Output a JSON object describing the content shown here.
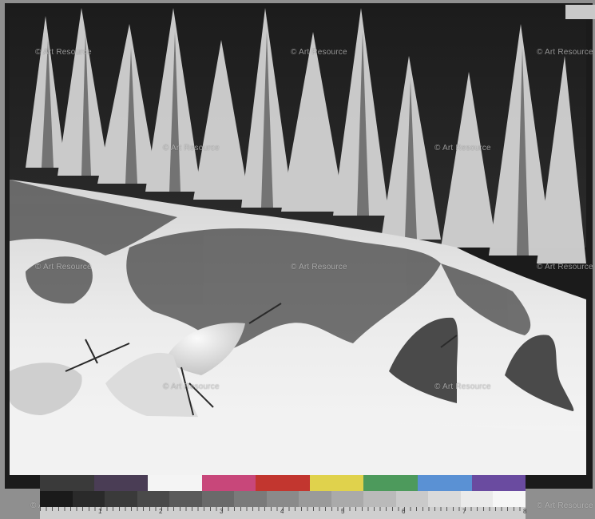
{
  "watermark_text": "© Art Resource",
  "colors": {
    "mount": "#1b1b1b",
    "snow_light": "#f0f0f0",
    "snow_mid": "#cdcdcd",
    "shadow": "#3a3a3a",
    "trees_dark": "#2a2a2a",
    "trees_snow": "#e4e4e4"
  },
  "color_swatches": [
    "#3a3a3a",
    "#4a3d55",
    "#f4f4f4",
    "#c8477a",
    "#c2362f",
    "#e0d24c",
    "#4d9a5c",
    "#5a91d4",
    "#6a4ba0"
  ],
  "gray_swatches": [
    "#1a1a1a",
    "#2a2a2a",
    "#3a3a3a",
    "#4a4a4a",
    "#5a5a5a",
    "#6a6a6a",
    "#7a7a7a",
    "#8a8a8a",
    "#9a9a9a",
    "#aaaaaa",
    "#bababa",
    "#cacaca",
    "#dadada",
    "#eaeaea",
    "#f6f6f6"
  ],
  "ruler_numbers": [
    "1",
    "2",
    "3",
    "4",
    "5",
    "6",
    "7",
    "8"
  ]
}
